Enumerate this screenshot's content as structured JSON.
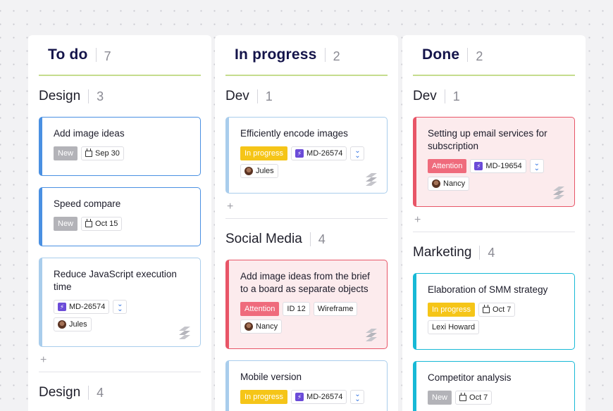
{
  "columns": [
    {
      "title": "To do",
      "count": "7",
      "groups": [
        {
          "title": "Design",
          "count": "3",
          "cards": [
            {
              "title": "Add image ideas",
              "badge": "New",
              "date": "Sep 30"
            },
            {
              "title": "Speed compare",
              "badge": "New",
              "date": "Oct 15"
            },
            {
              "title": "Reduce JavaScript execution time",
              "issue": "MD-26574",
              "assignee": "Jules"
            }
          ],
          "add": "+"
        },
        {
          "title": "Design",
          "count": "4"
        }
      ]
    },
    {
      "title": "In progress",
      "count": "2",
      "groups": [
        {
          "title": "Dev",
          "count": "1",
          "cards": [
            {
              "title": "Efficiently encode images",
              "badge": "In progress",
              "issue": "MD-26574",
              "assignee": "Jules"
            }
          ],
          "add": "+"
        },
        {
          "title": "Social Media",
          "count": "4",
          "cards": [
            {
              "title": "Add image ideas from the brief to a board as separate objects",
              "badge": "Attention",
              "id_tag": "ID 12",
              "type_tag": "Wireframe",
              "assignee": "Nancy"
            },
            {
              "title": "Mobile version",
              "badge": "In progress",
              "issue": "MD-26574"
            }
          ]
        }
      ]
    },
    {
      "title": "Done",
      "count": "2",
      "groups": [
        {
          "title": "Dev",
          "count": "1",
          "cards": [
            {
              "title": "Setting up email services for subscription",
              "badge": "Attention",
              "issue": "MD-19654",
              "assignee": "Nancy"
            }
          ],
          "add": "+"
        },
        {
          "title": "Marketing",
          "count": "4",
          "cards": [
            {
              "title": "Elaboration of SMM strategy",
              "badge": "In progress",
              "date": "Oct 7",
              "assignee": "Lexi Howard"
            },
            {
              "title": "Competitor analysis",
              "badge": "New",
              "date": "Oct 7"
            }
          ]
        }
      ]
    }
  ],
  "colors": {
    "blue_accent": "#4a90e2",
    "red_accent": "#e85567",
    "cyan_accent": "#17b9d6",
    "header_underline": "#c5dc8e",
    "badge_new": "#b3b3b8",
    "badge_progress": "#f5c518",
    "badge_attention": "#ef6b7c"
  }
}
